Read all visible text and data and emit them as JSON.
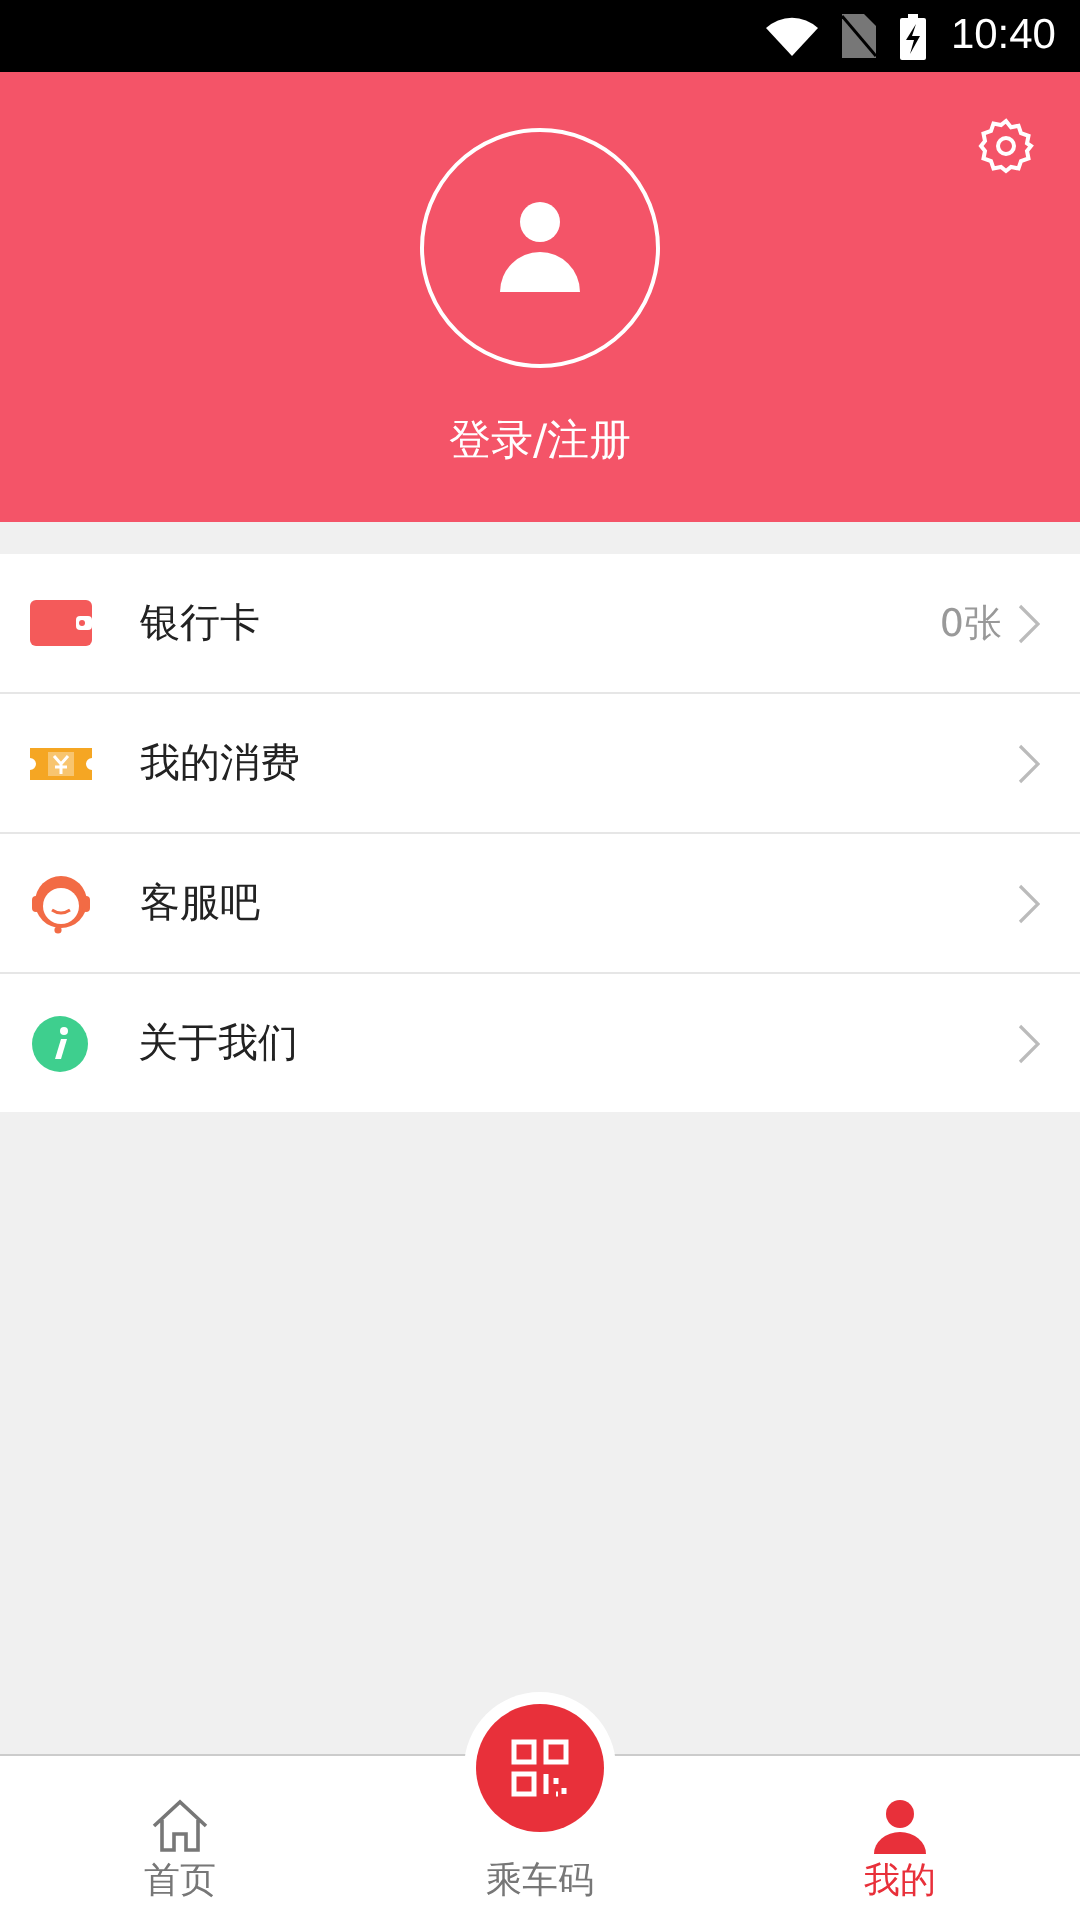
{
  "status_bar": {
    "time": "10:40"
  },
  "profile": {
    "login_label": "登录/注册"
  },
  "menu": [
    {
      "kind": "card",
      "label": "银行卡",
      "value": "0张"
    },
    {
      "kind": "spending",
      "label": "我的消费"
    },
    {
      "kind": "service",
      "label": "客服吧"
    },
    {
      "kind": "about",
      "label": "关于我们"
    }
  ],
  "tabs": [
    {
      "kind": "home",
      "label": "首页",
      "selected": false
    },
    {
      "kind": "qr",
      "label": "乘车码",
      "selected": false
    },
    {
      "kind": "me",
      "label": "我的",
      "selected": true
    }
  ]
}
